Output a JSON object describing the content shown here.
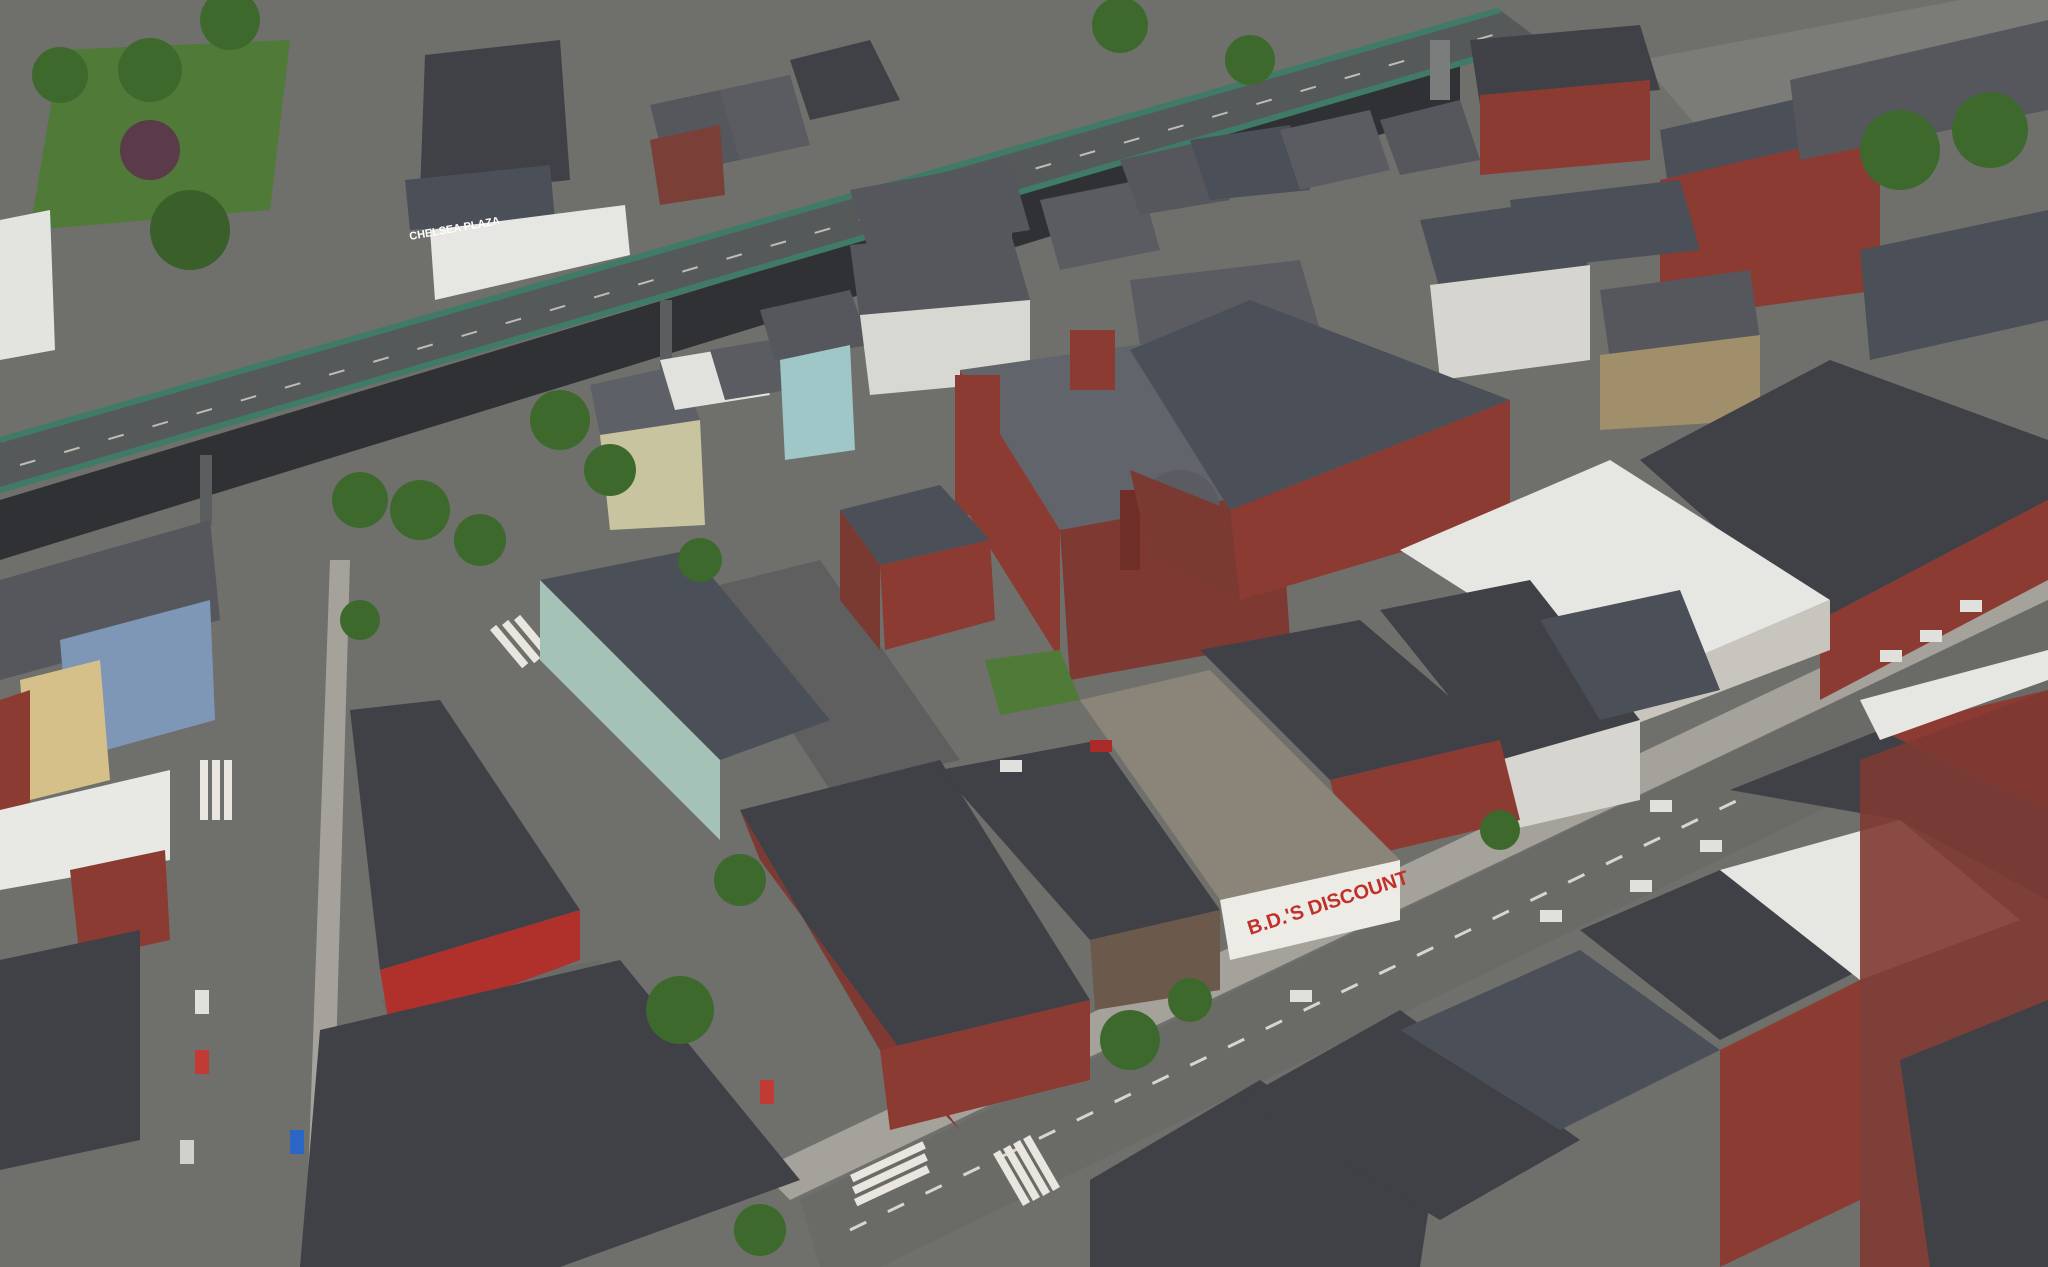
{
  "signs": {
    "discount": "B.D.'S DISCOUNT",
    "plaza": "CHELSEA PLAZA"
  },
  "colors": {
    "asphalt": "#6f6f6c",
    "sidewalk": "#a5a29b",
    "roof_dark": "#3f4146",
    "roof_mid": "#55575c",
    "roof_light": "#e6e6e2",
    "brick": "#8c3b32",
    "grass": "#4f7a37",
    "tree": "#3d6a2c",
    "highway": "#56595a",
    "highway_rail": "#3f7b67"
  }
}
